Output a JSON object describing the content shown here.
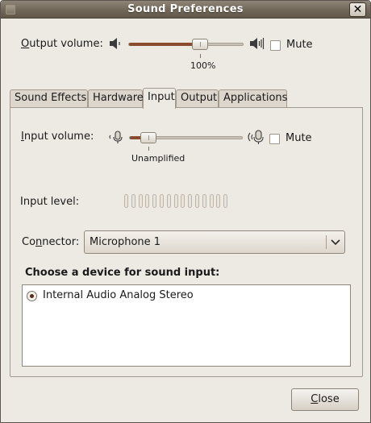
{
  "window": {
    "title": "Sound Preferences",
    "close_glyph": "✕"
  },
  "output_row": {
    "label_prefix": "O",
    "label_rest": "utput volume:",
    "value_caption": "100%",
    "level": 0.62,
    "mute_label": "Mute",
    "mute_checked": false,
    "low_icon": "speaker-low-icon",
    "high_icon": "speaker-high-icon"
  },
  "tabs": [
    {
      "label": "Sound Effects",
      "active": false
    },
    {
      "label": "Hardware",
      "active": false
    },
    {
      "label": "Input",
      "active": true
    },
    {
      "label": "Output",
      "active": false
    },
    {
      "label": "Applications",
      "active": false
    }
  ],
  "input_tab": {
    "volume_label_prefix": "I",
    "volume_label_rest": "nput volume:",
    "volume_caption": "Unamplified",
    "volume_level": 0.17,
    "mute_label": "Mute",
    "mute_checked": false,
    "low_icon": "microphone-low-icon",
    "high_icon": "microphone-high-icon",
    "input_level_label": "Input level:",
    "input_level_segments": 15,
    "input_level_value": 0,
    "connector_label_prefix": "Co",
    "connector_label_u": "n",
    "connector_label_rest": "nector:",
    "connector_value": "Microphone 1",
    "device_section_title_prefix": "C",
    "device_section_title_rest": "hoose a device for sound input:",
    "devices": [
      {
        "label": "Internal Audio Analog Stereo",
        "selected": true
      }
    ]
  },
  "footer": {
    "close_prefix": "C",
    "close_rest": "lose"
  },
  "colors": {
    "accent": "#8a4b2e",
    "titlebar": "#716759",
    "window_bg": "#ede9e3"
  }
}
